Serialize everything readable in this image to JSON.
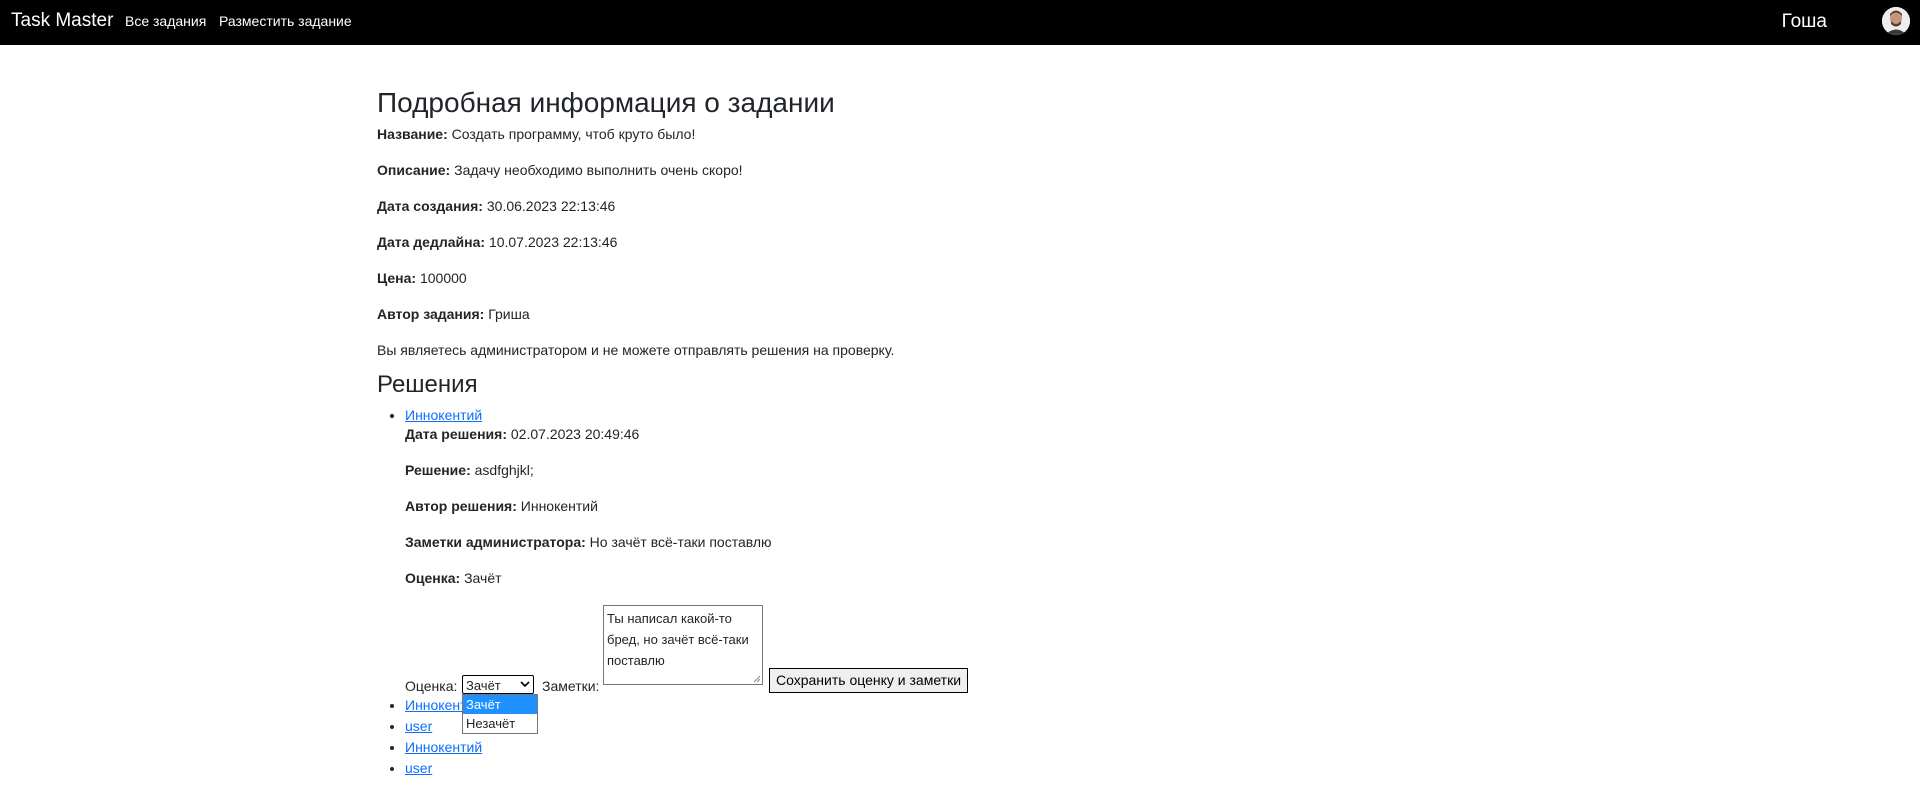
{
  "nav": {
    "brand": "Task Master",
    "links": [
      "Все задания",
      "Разместить задание"
    ],
    "user_name": "Гоша"
  },
  "page": {
    "title": "Подробная информация о задании",
    "fields": [
      {
        "label": "Название:",
        "value": "Создать программу, чтоб круто было!"
      },
      {
        "label": "Описание:",
        "value": "Задачу необходимо выполнить очень скоро!"
      },
      {
        "label": "Дата создания:",
        "value": "30.06.2023 22:13:46"
      },
      {
        "label": "Дата дедлайна:",
        "value": "10.07.2023 22:13:46"
      },
      {
        "label": "Цена:",
        "value": "100000"
      },
      {
        "label": "Автор задания:",
        "value": "Гриша"
      }
    ],
    "admin_notice": "Вы являетесь администратором и не можете отправлять решения на проверку."
  },
  "solutions": {
    "heading": "Решения",
    "expanded": {
      "author_link": "Иннокентий",
      "fields": [
        {
          "label": "Дата решения:",
          "value": "02.07.2023 20:49:46"
        },
        {
          "label": "Решение:",
          "value": "asdfghjkl;"
        },
        {
          "label": "Автор решения:",
          "value": "Иннокентий"
        },
        {
          "label": "Заметки администратора:",
          "value": "Но зачёт всё-таки поставлю"
        },
        {
          "label": "Оценка:",
          "value": "Зачёт"
        }
      ],
      "form": {
        "grade_label": "Оценка:",
        "grade_selected": "Зачёт",
        "grade_options": [
          "Зачёт",
          "Незачёт"
        ],
        "notes_label": "Заметки:",
        "notes_value": "Ты написал какой-то бред, но зачёт всё-таки поставлю",
        "save_label": "Сохранить оценку и заметки"
      }
    },
    "others": [
      "Иннокентий",
      "user",
      "Иннокентий",
      "user"
    ]
  }
}
